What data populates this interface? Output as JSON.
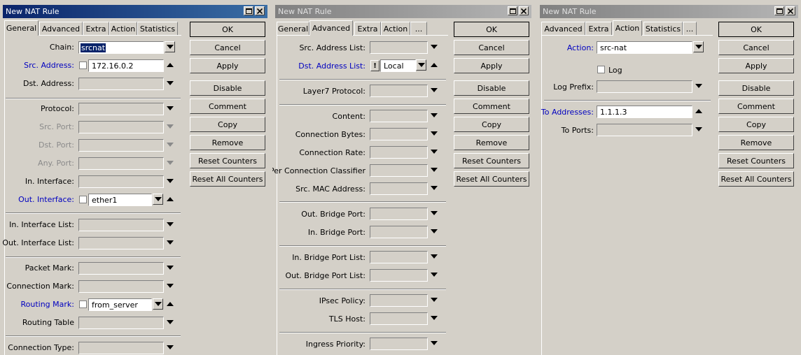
{
  "windows": [
    {
      "title": "New NAT Rule",
      "tabs": [
        "General",
        "Advanced",
        "Extra",
        "Action",
        "Statistics"
      ],
      "selected_tab": "General",
      "fields": [
        {
          "label": "Chain:",
          "value": "srcnat"
        },
        {
          "label": "Src. Address:",
          "value": "172.16.0.2"
        },
        {
          "label": "Dst. Address:",
          "value": ""
        },
        {
          "label": "Protocol:",
          "value": ""
        },
        {
          "label": "Src. Port:",
          "value": ""
        },
        {
          "label": "Dst. Port:",
          "value": ""
        },
        {
          "label": "Any. Port:",
          "value": ""
        },
        {
          "label": "In. Interface:",
          "value": ""
        },
        {
          "label": "Out. Interface:",
          "value": "ether1"
        },
        {
          "label": "In. Interface List:",
          "value": ""
        },
        {
          "label": "Out. Interface List:",
          "value": ""
        },
        {
          "label": "Packet Mark:",
          "value": ""
        },
        {
          "label": "Connection Mark:",
          "value": ""
        },
        {
          "label": "Routing Mark:",
          "value": "from_server"
        },
        {
          "label": "Routing Table",
          "value": ""
        },
        {
          "label": "Connection Type:",
          "value": ""
        }
      ]
    },
    {
      "title": "New NAT Rule",
      "tabs": [
        "General",
        "Advanced",
        "Extra",
        "Action",
        "..."
      ],
      "selected_tab": "Advanced",
      "fields": [
        {
          "label": "Src. Address List:",
          "value": ""
        },
        {
          "label": "Dst. Address List:",
          "value": "Local",
          "negate": "!"
        },
        {
          "label": "Layer7 Protocol:",
          "value": ""
        },
        {
          "label": "Content:",
          "value": ""
        },
        {
          "label": "Connection Bytes:",
          "value": ""
        },
        {
          "label": "Connection Rate:",
          "value": ""
        },
        {
          "label": "Per Connection Classifier",
          "value": ""
        },
        {
          "label": "Src. MAC Address:",
          "value": ""
        },
        {
          "label": "Out. Bridge Port:",
          "value": ""
        },
        {
          "label": "In. Bridge Port:",
          "value": ""
        },
        {
          "label": "In. Bridge Port List:",
          "value": ""
        },
        {
          "label": "Out. Bridge Port List:",
          "value": ""
        },
        {
          "label": "IPsec Policy:",
          "value": ""
        },
        {
          "label": "TLS Host:",
          "value": ""
        },
        {
          "label": "Ingress Priority:",
          "value": ""
        }
      ]
    },
    {
      "title": "New NAT Rule",
      "tabs": [
        "Advanced",
        "Extra",
        "Action",
        "Statistics",
        "..."
      ],
      "selected_tab": "Action",
      "fields": [
        {
          "label": "Action:",
          "value": "src-nat"
        },
        {
          "label": "Log",
          "value": ""
        },
        {
          "label": "Log Prefix:",
          "value": ""
        },
        {
          "label": "To Addresses:",
          "value": "1.1.1.3"
        },
        {
          "label": "To Ports:",
          "value": ""
        }
      ]
    }
  ],
  "buttons": [
    "OK",
    "Cancel",
    "Apply",
    "Disable",
    "Comment",
    "Copy",
    "Remove",
    "Reset Counters",
    "Reset All Counters"
  ],
  "colors": {
    "title_active": "#0a246a",
    "title_inactive": "#808080",
    "label_blue": "#0000c0",
    "face": "#d4d0c8"
  }
}
